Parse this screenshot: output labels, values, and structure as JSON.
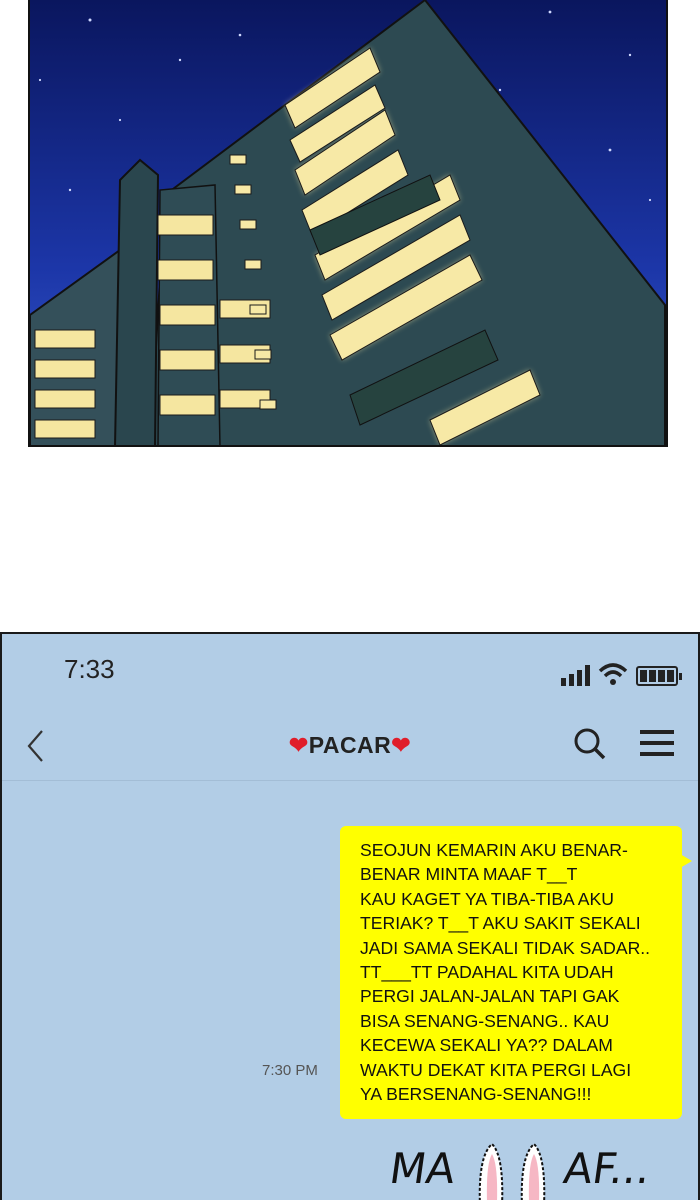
{
  "status_bar": {
    "time": "7:33"
  },
  "chat": {
    "title": "PACAR",
    "heart_glyph": "❤",
    "message": {
      "text": "SEOJUN KEMARIN AKU BENAR-\nBENAR MINTA MAAF T__T\nKAU KAGET YA TIBA-TIBA AKU\nTERIAK? T__T AKU SAKIT SEKALI\nJADI SAMA SEKALI TIDAK SADAR..\nTT___TT PADAHAL KITA UDAH\nPERGI JALAN-JALAN TAPI GAK\nBISA SENANG-SENANG.. KAU\nKECEWA SEKALI YA?? DALAM\nWAKTU DEKAT KITA PERGI LAGI\nYA BERSENANG-SENANG!!!",
      "time": "7:30 PM"
    },
    "sticker": {
      "left_text": "MA",
      "right_text": "AF...",
      "icon": "bunny-ears-icon"
    }
  },
  "icons": [
    "back-chevron-icon",
    "search-icon",
    "menu-icon",
    "signal-icon",
    "wifi-icon",
    "battery-icon"
  ],
  "colors": {
    "chat_background": "#b2cde6",
    "bubble": "#ffff00",
    "heart": "#e01d2a",
    "night_sky": "#0c1a7a"
  }
}
